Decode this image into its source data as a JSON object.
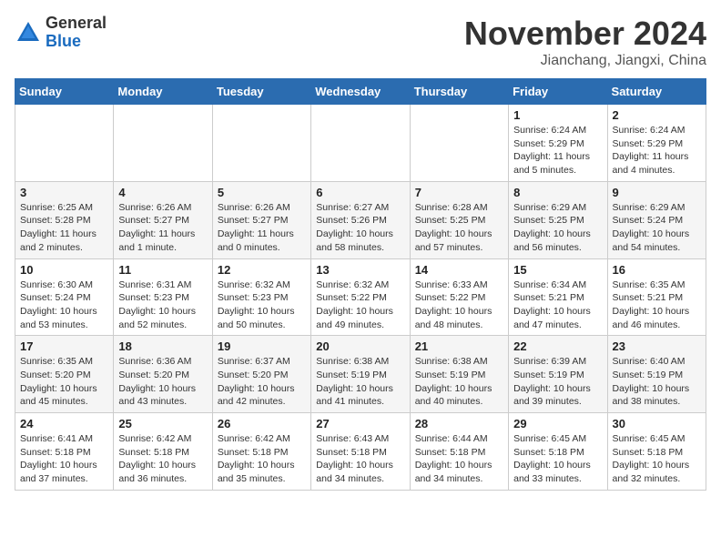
{
  "header": {
    "logo_general": "General",
    "logo_blue": "Blue",
    "month_title": "November 2024",
    "subtitle": "Jianchang, Jiangxi, China"
  },
  "weekdays": [
    "Sunday",
    "Monday",
    "Tuesday",
    "Wednesday",
    "Thursday",
    "Friday",
    "Saturday"
  ],
  "weeks": [
    [
      null,
      null,
      null,
      null,
      null,
      {
        "day": "1",
        "sunrise": "6:24 AM",
        "sunset": "5:29 PM",
        "daylight": "11 hours and 5 minutes."
      },
      {
        "day": "2",
        "sunrise": "6:24 AM",
        "sunset": "5:29 PM",
        "daylight": "11 hours and 4 minutes."
      }
    ],
    [
      {
        "day": "3",
        "sunrise": "6:25 AM",
        "sunset": "5:28 PM",
        "daylight": "11 hours and 2 minutes."
      },
      {
        "day": "4",
        "sunrise": "6:26 AM",
        "sunset": "5:27 PM",
        "daylight": "11 hours and 1 minute."
      },
      {
        "day": "5",
        "sunrise": "6:26 AM",
        "sunset": "5:27 PM",
        "daylight": "11 hours and 0 minutes."
      },
      {
        "day": "6",
        "sunrise": "6:27 AM",
        "sunset": "5:26 PM",
        "daylight": "10 hours and 58 minutes."
      },
      {
        "day": "7",
        "sunrise": "6:28 AM",
        "sunset": "5:25 PM",
        "daylight": "10 hours and 57 minutes."
      },
      {
        "day": "8",
        "sunrise": "6:29 AM",
        "sunset": "5:25 PM",
        "daylight": "10 hours and 56 minutes."
      },
      {
        "day": "9",
        "sunrise": "6:29 AM",
        "sunset": "5:24 PM",
        "daylight": "10 hours and 54 minutes."
      }
    ],
    [
      {
        "day": "10",
        "sunrise": "6:30 AM",
        "sunset": "5:24 PM",
        "daylight": "10 hours and 53 minutes."
      },
      {
        "day": "11",
        "sunrise": "6:31 AM",
        "sunset": "5:23 PM",
        "daylight": "10 hours and 52 minutes."
      },
      {
        "day": "12",
        "sunrise": "6:32 AM",
        "sunset": "5:23 PM",
        "daylight": "10 hours and 50 minutes."
      },
      {
        "day": "13",
        "sunrise": "6:32 AM",
        "sunset": "5:22 PM",
        "daylight": "10 hours and 49 minutes."
      },
      {
        "day": "14",
        "sunrise": "6:33 AM",
        "sunset": "5:22 PM",
        "daylight": "10 hours and 48 minutes."
      },
      {
        "day": "15",
        "sunrise": "6:34 AM",
        "sunset": "5:21 PM",
        "daylight": "10 hours and 47 minutes."
      },
      {
        "day": "16",
        "sunrise": "6:35 AM",
        "sunset": "5:21 PM",
        "daylight": "10 hours and 46 minutes."
      }
    ],
    [
      {
        "day": "17",
        "sunrise": "6:35 AM",
        "sunset": "5:20 PM",
        "daylight": "10 hours and 45 minutes."
      },
      {
        "day": "18",
        "sunrise": "6:36 AM",
        "sunset": "5:20 PM",
        "daylight": "10 hours and 43 minutes."
      },
      {
        "day": "19",
        "sunrise": "6:37 AM",
        "sunset": "5:20 PM",
        "daylight": "10 hours and 42 minutes."
      },
      {
        "day": "20",
        "sunrise": "6:38 AM",
        "sunset": "5:19 PM",
        "daylight": "10 hours and 41 minutes."
      },
      {
        "day": "21",
        "sunrise": "6:38 AM",
        "sunset": "5:19 PM",
        "daylight": "10 hours and 40 minutes."
      },
      {
        "day": "22",
        "sunrise": "6:39 AM",
        "sunset": "5:19 PM",
        "daylight": "10 hours and 39 minutes."
      },
      {
        "day": "23",
        "sunrise": "6:40 AM",
        "sunset": "5:19 PM",
        "daylight": "10 hours and 38 minutes."
      }
    ],
    [
      {
        "day": "24",
        "sunrise": "6:41 AM",
        "sunset": "5:18 PM",
        "daylight": "10 hours and 37 minutes."
      },
      {
        "day": "25",
        "sunrise": "6:42 AM",
        "sunset": "5:18 PM",
        "daylight": "10 hours and 36 minutes."
      },
      {
        "day": "26",
        "sunrise": "6:42 AM",
        "sunset": "5:18 PM",
        "daylight": "10 hours and 35 minutes."
      },
      {
        "day": "27",
        "sunrise": "6:43 AM",
        "sunset": "5:18 PM",
        "daylight": "10 hours and 34 minutes."
      },
      {
        "day": "28",
        "sunrise": "6:44 AM",
        "sunset": "5:18 PM",
        "daylight": "10 hours and 34 minutes."
      },
      {
        "day": "29",
        "sunrise": "6:45 AM",
        "sunset": "5:18 PM",
        "daylight": "10 hours and 33 minutes."
      },
      {
        "day": "30",
        "sunrise": "6:45 AM",
        "sunset": "5:18 PM",
        "daylight": "10 hours and 32 minutes."
      }
    ]
  ]
}
